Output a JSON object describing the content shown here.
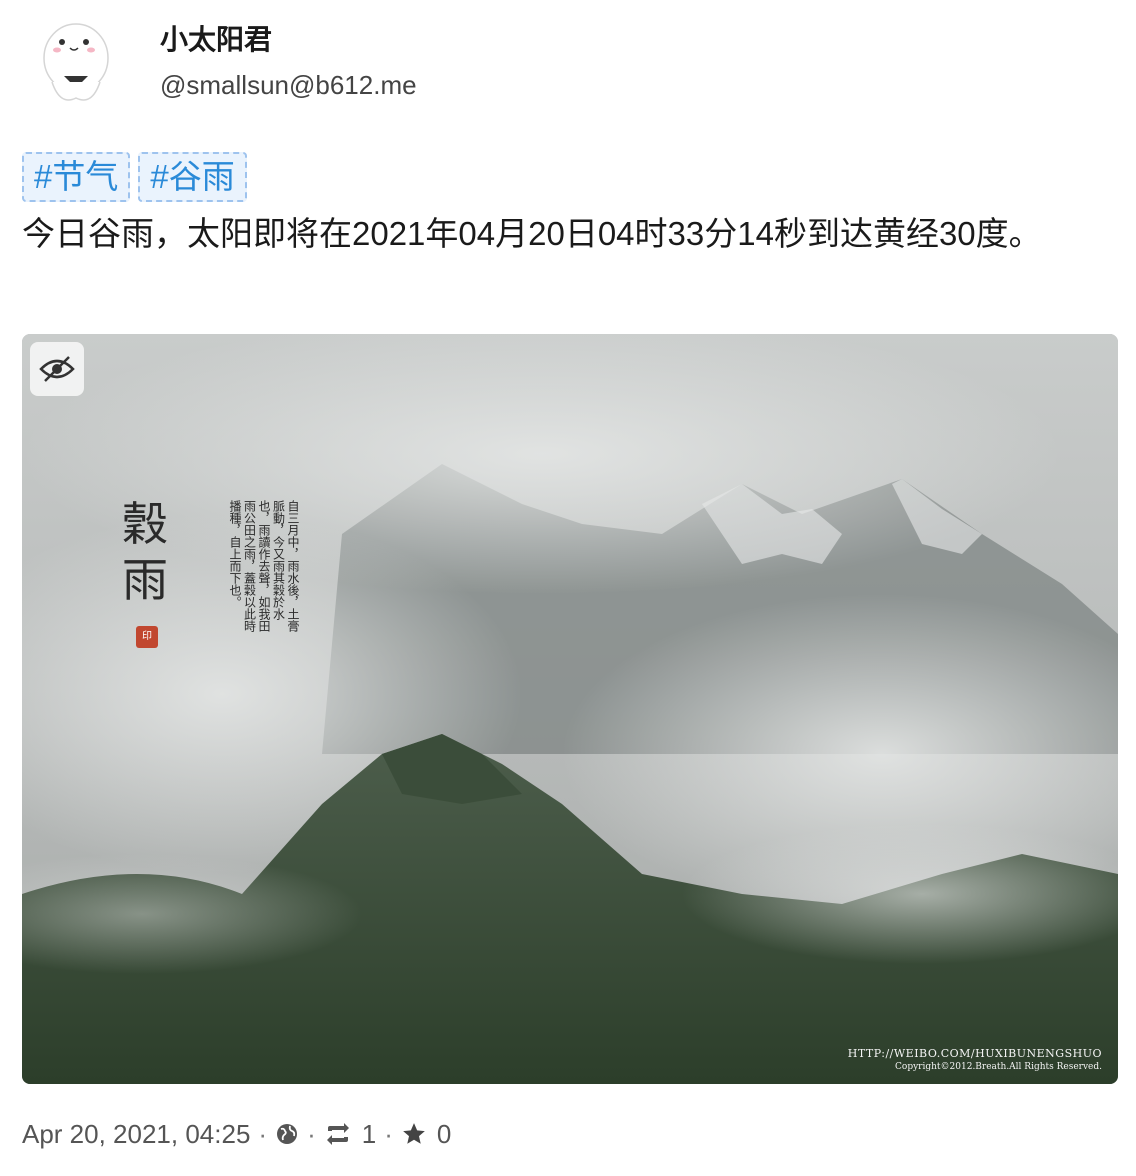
{
  "account": {
    "display_name": "小太阳君",
    "acct": "@smallsun@b612.me"
  },
  "content": {
    "tags": [
      "#节气",
      "#谷雨"
    ],
    "text": "今日谷雨，太阳即将在2021年04月20日04时33分14秒到达黄经30度。"
  },
  "media": {
    "poem_title": "穀雨",
    "poem_text": "自三月中，雨水後，土膏脈動，今又雨其穀於水也，雨讀作去聲，如我田雨公田之雨，蓋穀以此時播種，自上而下也。",
    "seal_text": "印",
    "credit_url": "HTTP://WEIBO.COM/HUXIBUNENGSHUO",
    "credit_copyright": "Copyright©2012.Breath.All Rights Reserved."
  },
  "footer": {
    "timestamp": "Apr 20, 2021, 04:25",
    "separator": "·",
    "visibility_icon": "globe-icon",
    "boost_count": "1",
    "favourite_count": "0"
  },
  "colors": {
    "hashtag_text": "#2a8ad8",
    "hashtag_bg": "#eaf3fd",
    "seal": "#c1472f"
  }
}
